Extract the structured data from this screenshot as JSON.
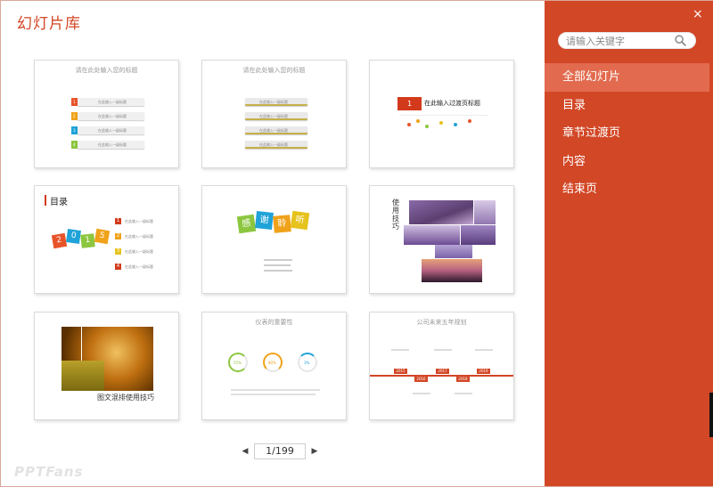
{
  "window": {
    "title": "幻灯片库",
    "close": "×"
  },
  "search": {
    "placeholder": "请输入关键字"
  },
  "nav": {
    "items": [
      "全部幻灯片",
      "目录",
      "章节过渡页",
      "内容",
      "结束页"
    ],
    "active": 0
  },
  "pager": {
    "prev": "◀",
    "next": "▶",
    "page": "1/199"
  },
  "brand": "PPTFans",
  "colors": {
    "accent": "#d24726",
    "active_item": "#e26b4f"
  },
  "cards": [
    {
      "title": "请在此处输入您的标题",
      "rows": [
        "在此输入一级标题",
        "在此输入一级标题",
        "在此输入一级标题",
        "在此输入一级标题"
      ],
      "nums": [
        "1",
        "2",
        "3",
        "4"
      ]
    },
    {
      "title": "请在此处输入您的标题",
      "rows": [
        "在此输入一级标题",
        "在此输入一级标题",
        "在此输入一级标题",
        "在此输入一级标题"
      ]
    },
    {
      "num": "1",
      "heading": "在此输入过渡页标题"
    },
    {
      "heading": "目录",
      "year": [
        "2",
        "0",
        "1",
        "5"
      ],
      "rows": [
        "在此输入一级标题",
        "在此输入一级标题",
        "在此输入一级标题",
        "在此输入一级标题"
      ],
      "nums": [
        "1",
        "2",
        "3",
        "4"
      ]
    },
    {
      "chars": [
        "感",
        "谢",
        "聆",
        "听"
      ]
    },
    {
      "heading": "使用技巧"
    },
    {
      "heading": "图文混排使用技巧"
    },
    {
      "title": "仪表的重要性",
      "gauges": [
        "55%",
        "80%",
        "3%"
      ]
    },
    {
      "title": "公司未来五年规划",
      "years": [
        "2015",
        "2016",
        "2017",
        "2018",
        "2019"
      ]
    }
  ]
}
